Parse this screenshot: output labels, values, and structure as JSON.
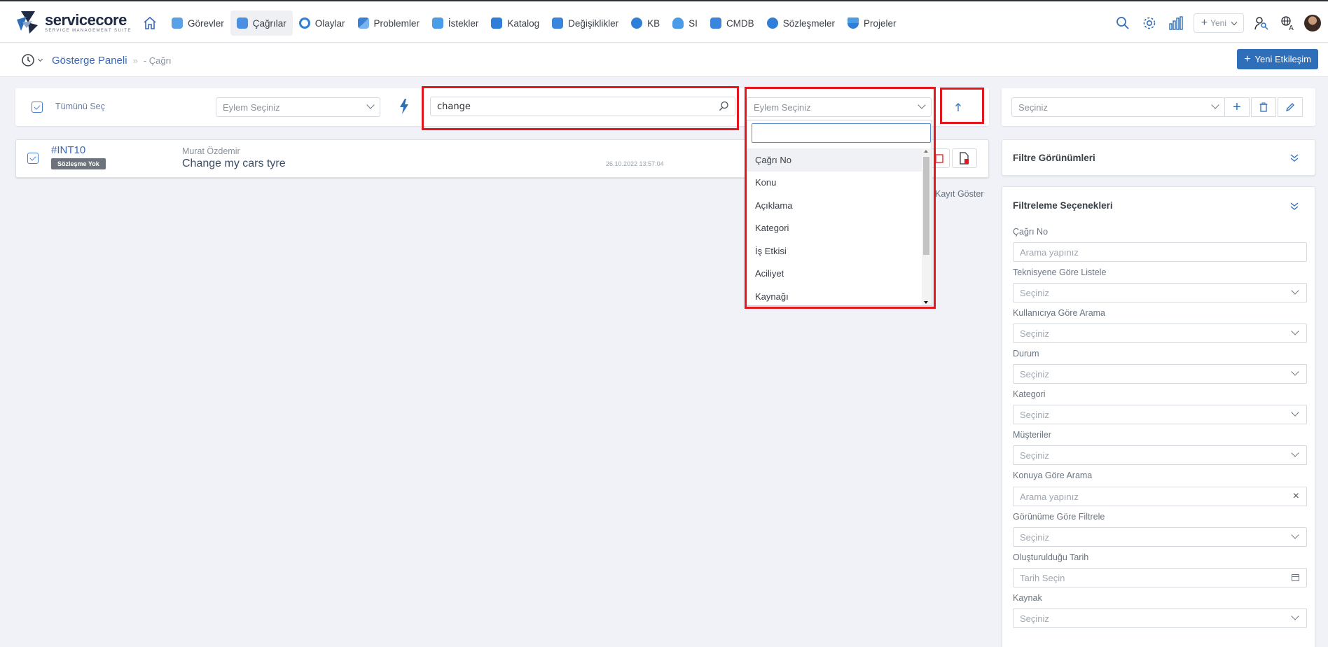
{
  "brand": {
    "name_a": "service",
    "name_b": "core",
    "tagline": "SERVICE MANAGEMENT SUITE"
  },
  "nav": {
    "items": [
      {
        "label": "Görevler",
        "icon": "tasks-icon",
        "color": "#5aa0e6"
      },
      {
        "label": "Çağrılar",
        "icon": "calls-icon",
        "color": "#4a90e2",
        "active": true
      },
      {
        "label": "Olaylar",
        "icon": "incidents-icon",
        "color": "#2f7fd8"
      },
      {
        "label": "Problemler",
        "icon": "problems-icon",
        "color": "#3b82d6"
      },
      {
        "label": "İstekler",
        "icon": "requests-icon",
        "color": "#4a9be8"
      },
      {
        "label": "Katalog",
        "icon": "catalog-icon",
        "color": "#2f7fd8"
      },
      {
        "label": "Değişiklikler",
        "icon": "changes-icon",
        "color": "#3a86dc"
      },
      {
        "label": "KB",
        "icon": "kb-icon",
        "color": "#2f7fd8"
      },
      {
        "label": "SI",
        "icon": "si-icon",
        "color": "#4a9be8"
      },
      {
        "label": "CMDB",
        "icon": "cmdb-icon",
        "color": "#3a86dc"
      },
      {
        "label": "Sözleşmeler",
        "icon": "contracts-icon",
        "color": "#2f7fd8"
      },
      {
        "label": "Projeler",
        "icon": "projects-icon",
        "color": "#4a9be8"
      }
    ],
    "new_label": "Yeni"
  },
  "breadcrumb": {
    "home": "Gösterge Paneli",
    "current": "Çağrı"
  },
  "new_interaction_label": "Yeni Etkileşim",
  "toolbar": {
    "select_all": "Tümünü Seç",
    "action_placeholder": "Eylem Seçiniz",
    "search_value": "change",
    "field_placeholder": "Eylem Seçiniz"
  },
  "row": {
    "id": "#INT10",
    "badge": "Sözleşme Yok",
    "owner": "Murat Özdemir",
    "subject": "Change my cars tyre",
    "date": "26.10.2022 13:57:04"
  },
  "show_records": "Kayıt Göster",
  "dropdown": {
    "options": [
      "Çağrı No",
      "Konu",
      "Açıklama",
      "Kategori",
      "İş Etkisi",
      "Aciliyet",
      "Kaynağı"
    ]
  },
  "right_panel": {
    "view_select_placeholder": "Seçiniz",
    "filter_views_title": "Filtre Görünümleri",
    "filter_options_title": "Filtreleme Seçenekleri",
    "fields": [
      {
        "label": "Çağrı No",
        "placeholder": "Arama yapınız",
        "kind": "text"
      },
      {
        "label": "Teknisyene Göre Listele",
        "placeholder": "Seçiniz",
        "kind": "select"
      },
      {
        "label": "Kullanıcıya Göre Arama",
        "placeholder": "Seçiniz",
        "kind": "select"
      },
      {
        "label": "Durum",
        "placeholder": "Seçiniz",
        "kind": "select"
      },
      {
        "label": "Kategori",
        "placeholder": "Seçiniz",
        "kind": "select"
      },
      {
        "label": "Müşteriler",
        "placeholder": "Seçiniz",
        "kind": "select"
      },
      {
        "label": "Konuya Göre Arama",
        "placeholder": "Arama yapınız",
        "kind": "clear"
      },
      {
        "label": "Görünüme Göre Filtrele",
        "placeholder": "Seçiniz",
        "kind": "select"
      },
      {
        "label": "Oluşturulduğu Tarih",
        "placeholder": "Tarih Seçin",
        "kind": "date"
      },
      {
        "label": "Kaynak",
        "placeholder": "Seçiniz",
        "kind": "select"
      }
    ]
  }
}
